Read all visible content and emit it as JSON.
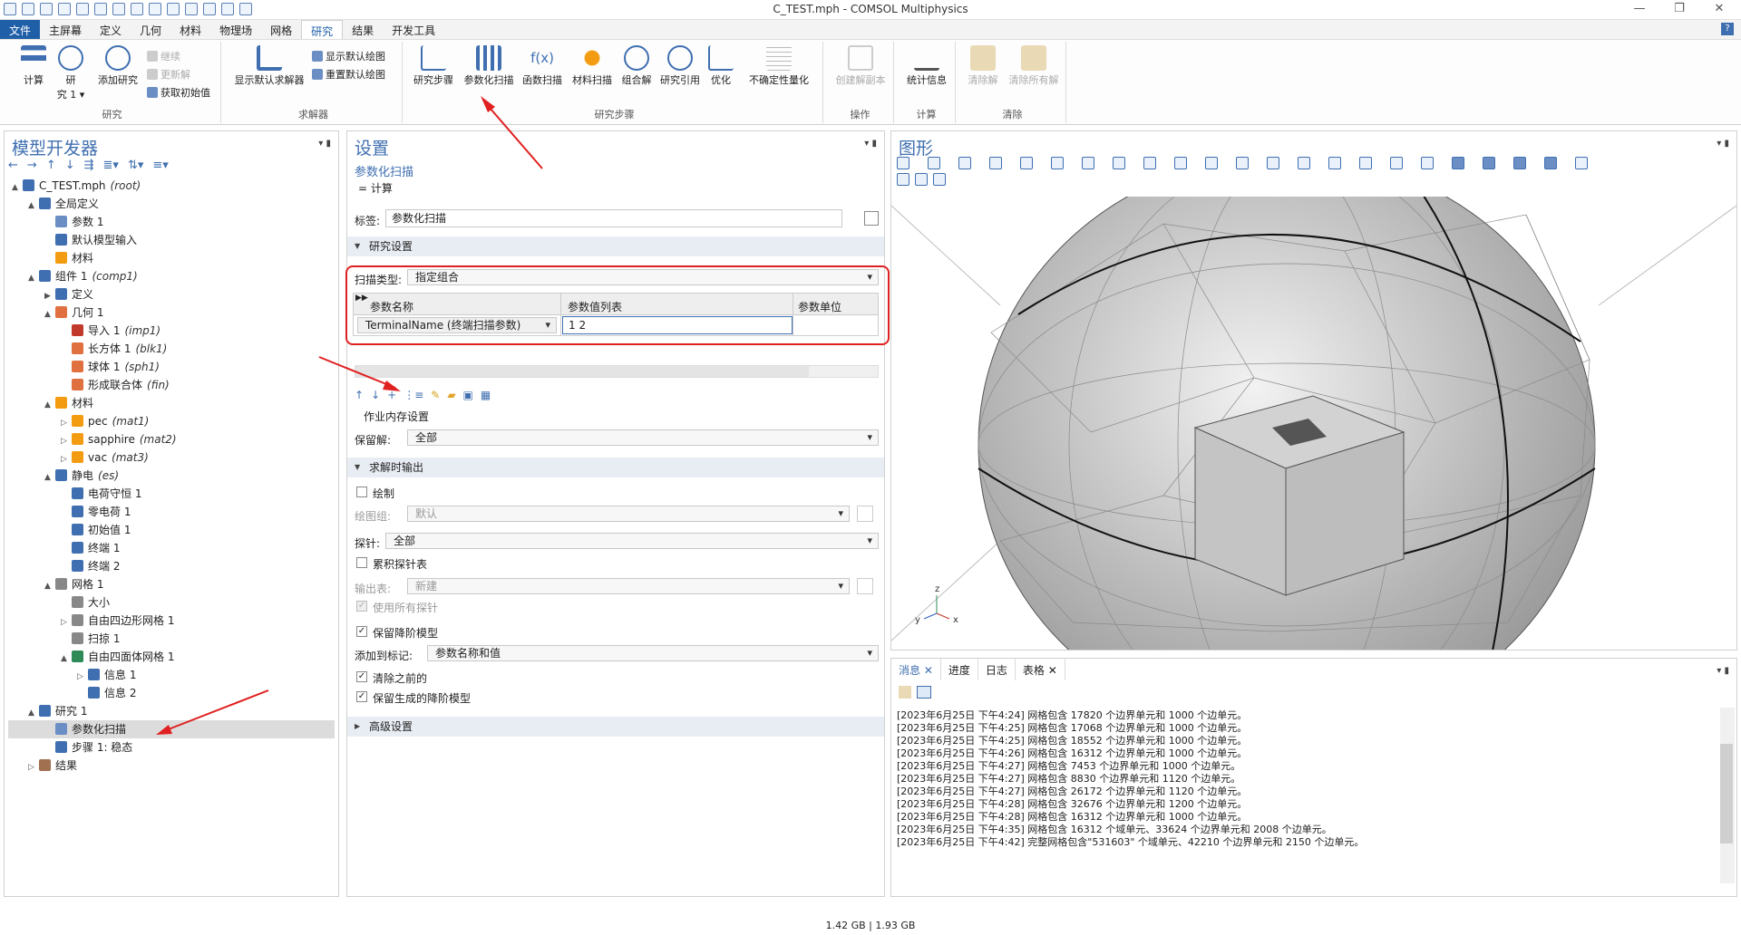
{
  "window": {
    "title": "C_TEST.mph - COMSOL Multiphysics"
  },
  "menu": [
    "文件",
    "主屏幕",
    "定义",
    "几何",
    "材料",
    "物理场",
    "网格",
    "研究",
    "结果",
    "开发工具"
  ],
  "ribbon": {
    "study_group": {
      "label": "研究",
      "compute": "计算",
      "study": "研\n究 1 ▾",
      "add_study": "添加研究",
      "continue": "继续",
      "update": "更新解",
      "get_initial": "获取初始值"
    },
    "solver_group": {
      "label": "求解器",
      "show_default": "显示默认求解器",
      "show_default_plot": "显示默认绘图",
      "reset_default_plot": "重置默认绘图"
    },
    "steps_group": {
      "label": "研究步骤",
      "study_steps": "研究步骤",
      "param_sweep": "参数化扫描",
      "func_sweep": "函数扫描",
      "mat_sweep": "材料扫描",
      "combo_solve": "组合解",
      "study_ref": "研究引用",
      "optimize": "优化",
      "uq": "不确定性量化"
    },
    "ops_group": {
      "label": "操作",
      "create_copy": "创建解副本"
    },
    "calc_group": {
      "label": "计算",
      "stats": "统计信息"
    },
    "clear_group": {
      "label": "清除",
      "clear_sol": "清除解",
      "clear_all": "清除所有解"
    }
  },
  "model_builder": {
    "title": "模型开发器",
    "tree": [
      {
        "label": "C_TEST.mph",
        "tag": "(root)",
        "level": 0,
        "exp": "▲"
      },
      {
        "label": "全局定义",
        "tag": "",
        "level": 1,
        "exp": "▲"
      },
      {
        "label": "参数 1",
        "tag": "",
        "level": 2,
        "exp": ""
      },
      {
        "label": "默认模型输入",
        "tag": "",
        "level": 2,
        "exp": ""
      },
      {
        "label": "材料",
        "tag": "",
        "level": 2,
        "exp": ""
      },
      {
        "label": "组件 1",
        "tag": "(comp1)",
        "level": 1,
        "exp": "▲"
      },
      {
        "label": "定义",
        "tag": "",
        "level": 2,
        "exp": "▶"
      },
      {
        "label": "几何 1",
        "tag": "",
        "level": 2,
        "exp": "▲"
      },
      {
        "label": "导入 1",
        "tag": "(imp1)",
        "level": 3,
        "exp": ""
      },
      {
        "label": "长方体 1",
        "tag": "(blk1)",
        "level": 3,
        "exp": ""
      },
      {
        "label": "球体 1",
        "tag": "(sph1)",
        "level": 3,
        "exp": ""
      },
      {
        "label": "形成联合体",
        "tag": "(fin)",
        "level": 3,
        "exp": ""
      },
      {
        "label": "材料",
        "tag": "",
        "level": 2,
        "exp": "▲"
      },
      {
        "label": "pec",
        "tag": "(mat1)",
        "level": 3,
        "exp": "▷"
      },
      {
        "label": "sapphire",
        "tag": "(mat2)",
        "level": 3,
        "exp": "▷"
      },
      {
        "label": "vac",
        "tag": "(mat3)",
        "level": 3,
        "exp": "▷"
      },
      {
        "label": "静电",
        "tag": "(es)",
        "level": 2,
        "exp": "▲"
      },
      {
        "label": "电荷守恒 1",
        "tag": "",
        "level": 3,
        "exp": ""
      },
      {
        "label": "零电荷 1",
        "tag": "",
        "level": 3,
        "exp": ""
      },
      {
        "label": "初始值 1",
        "tag": "",
        "level": 3,
        "exp": ""
      },
      {
        "label": "终端 1",
        "tag": "",
        "level": 3,
        "exp": ""
      },
      {
        "label": "终端 2",
        "tag": "",
        "level": 3,
        "exp": ""
      },
      {
        "label": "网格 1",
        "tag": "",
        "level": 2,
        "exp": "▲"
      },
      {
        "label": "大小",
        "tag": "",
        "level": 3,
        "exp": ""
      },
      {
        "label": "自由四边形网格 1",
        "tag": "",
        "level": 3,
        "exp": "▷"
      },
      {
        "label": "扫掠 1",
        "tag": "",
        "level": 3,
        "exp": ""
      },
      {
        "label": "自由四面体网格 1",
        "tag": "",
        "level": 3,
        "exp": "▲"
      },
      {
        "label": "信息 1",
        "tag": "",
        "level": 4,
        "exp": "▷"
      },
      {
        "label": "信息 2",
        "tag": "",
        "level": 4,
        "exp": ""
      },
      {
        "label": "研究 1",
        "tag": "",
        "level": 1,
        "exp": "▲"
      },
      {
        "label": "参数化扫描",
        "tag": "",
        "level": 2,
        "exp": "",
        "selected": true
      },
      {
        "label": "步骤 1: 稳态",
        "tag": "",
        "level": 2,
        "exp": ""
      },
      {
        "label": "结果",
        "tag": "",
        "level": 1,
        "exp": "▷"
      }
    ]
  },
  "settings": {
    "title": "设置",
    "subtitle": "参数化扫描",
    "compute": "= 计算",
    "label_field": "标签:",
    "label_value": "参数化扫描",
    "study_settings": "研究设置",
    "sweep_type_label": "扫描类型:",
    "sweep_type": "指定组合",
    "table_headers": [
      "参数名称",
      "参数值列表",
      "参数单位"
    ],
    "param_name": "TerminalName (终端扫描参数)",
    "param_values": "1 2",
    "param_unit": "",
    "mem_settings": "作业内存设置",
    "keep_solution_label": "保留解:",
    "keep_solution": "全部",
    "output_section": "求解时输出",
    "plot_label": "绘制",
    "plot_group_label": "绘图组:",
    "plot_group": "默认",
    "probe_label": "探针:",
    "probe": "全部",
    "accum_table": "累积探针表",
    "output_table_label": "输出表:",
    "output_table": "新建",
    "use_all_probes": "使用所有探针",
    "keep_reduced": "保留降阶模型",
    "add_to_tag_label": "添加到标记:",
    "add_to_tag": "参数名称和值",
    "clear_previous": "清除之前的",
    "keep_generated": "保留生成的降阶模型",
    "advanced": "高级设置"
  },
  "graphics": {
    "title": "图形"
  },
  "messages": {
    "tabs": [
      "消息",
      "进度",
      "日志",
      "表格"
    ],
    "lines": [
      "[2023年6月25日 下午4:24] 网格包含 17820 个边界单元和 1000 个边单元。",
      "[2023年6月25日 下午4:25] 网格包含 17068 个边界单元和 1000 个边单元。",
      "[2023年6月25日 下午4:25] 网格包含 18552 个边界单元和 1000 个边单元。",
      "[2023年6月25日 下午4:26] 网格包含 16312 个边界单元和 1000 个边单元。",
      "[2023年6月25日 下午4:27] 网格包含 7453 个边界单元和 1000 个边单元。",
      "[2023年6月25日 下午4:27] 网格包含 8830 个边界单元和 1120 个边单元。",
      "[2023年6月25日 下午4:27] 网格包含 26172 个边界单元和 1120 个边单元。",
      "[2023年6月25日 下午4:28] 网格包含 32676 个边界单元和 1200 个边单元。",
      "[2023年6月25日 下午4:28] 网格包含 16312 个边界单元和 1000 个边单元。",
      "[2023年6月25日 下午4:35] 网格包含 16312 个域单元、33624 个边界单元和 2008 个边单元。",
      "[2023年6月25日 下午4:42] 完整网格包含\"531603\" 个域单元、42210 个边界单元和 2150 个边单元。"
    ]
  },
  "status": {
    "memory": "1.42 GB | 1.93 GB"
  },
  "colors": {
    "accent": "#3f6fb0",
    "highlight": "#e02020",
    "file_menu": "#1f5fa8"
  }
}
